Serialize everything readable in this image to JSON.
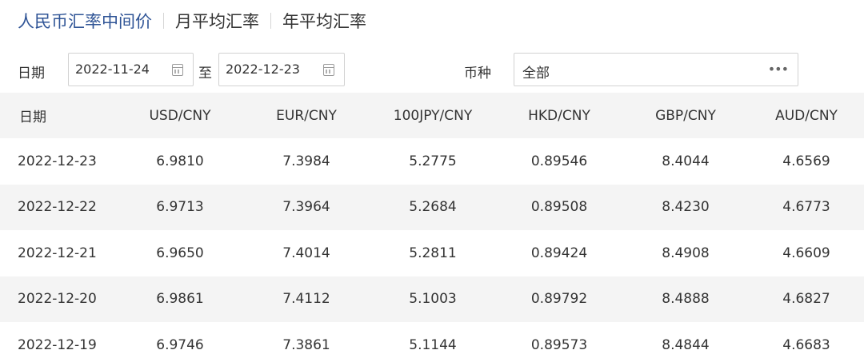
{
  "tabs": [
    {
      "label": "人民币汇率中间价",
      "active": true
    },
    {
      "label": "月平均汇率",
      "active": false
    },
    {
      "label": "年平均汇率",
      "active": false
    }
  ],
  "filter": {
    "date_label": "日期",
    "start_date": "2022-11-24",
    "range_sep": "至",
    "end_date": "2022-12-23",
    "currency_label": "币种",
    "currency_value": "全部"
  },
  "table": {
    "headers": [
      "日期",
      "USD/CNY",
      "EUR/CNY",
      "100JPY/CNY",
      "HKD/CNY",
      "GBP/CNY",
      "AUD/CNY"
    ],
    "rows": [
      [
        "2022-12-23",
        "6.9810",
        "7.3984",
        "5.2775",
        "0.89546",
        "8.4044",
        "4.6569"
      ],
      [
        "2022-12-22",
        "6.9713",
        "7.3964",
        "5.2684",
        "0.89508",
        "8.4230",
        "4.6773"
      ],
      [
        "2022-12-21",
        "6.9650",
        "7.4014",
        "5.2811",
        "0.89424",
        "8.4908",
        "4.6609"
      ],
      [
        "2022-12-20",
        "6.9861",
        "7.4112",
        "5.1003",
        "0.89792",
        "8.4888",
        "4.6827"
      ],
      [
        "2022-12-19",
        "6.9746",
        "7.3861",
        "5.1144",
        "0.89573",
        "8.4844",
        "4.6683"
      ]
    ]
  },
  "colors": {
    "accent": "#2f5496",
    "stripe": "#f4f4f4",
    "border": "#d2d2d2"
  }
}
